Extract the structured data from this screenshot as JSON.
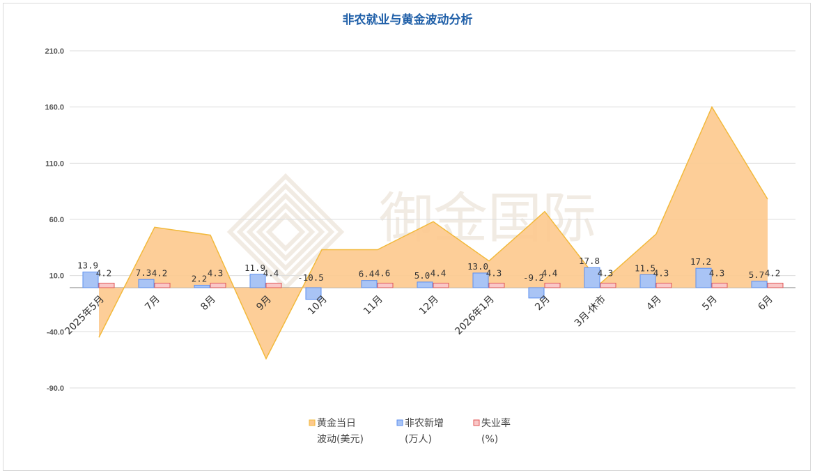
{
  "chart_data": {
    "type": "bar",
    "title": "非农就业与黄金波动分析",
    "categories": [
      "2025年5月",
      "7月",
      "8月",
      "9月",
      "10月",
      "11月",
      "12月",
      "2026年1月",
      "2月",
      "3月-休市",
      "4月",
      "5月",
      "6月"
    ],
    "ylim": [
      -90,
      210
    ],
    "yticks": [
      "210.0",
      "160.0",
      "110.0",
      "60.0",
      "10.0",
      "-40.0",
      "-90.0"
    ],
    "ytick_values": [
      210,
      160,
      110,
      60,
      10,
      -40,
      -90
    ],
    "grid": true,
    "legend_position": "bottom",
    "series": [
      {
        "name": "黄金当日波动(美元)",
        "type": "area",
        "color": "#fdc98d",
        "line_color": "#f2b93b",
        "values": [
          -45,
          53,
          46,
          -64,
          33,
          33,
          58,
          23,
          67,
          3,
          47,
          160,
          78
        ]
      },
      {
        "name": "非农新增(万人)",
        "type": "bar",
        "color": "#a9c4f5",
        "border": "#5b8ff0",
        "values": [
          13.9,
          7.3,
          2.2,
          11.9,
          -10.5,
          6.4,
          5.0,
          13.0,
          -9.2,
          17.8,
          11.5,
          17.2,
          5.7
        ],
        "labels": [
          "13.9",
          "7.3",
          "2.2",
          "11.9",
          "-10.5",
          "6.4",
          "5.0",
          "13.0",
          "-9.2",
          "17.8",
          "11.5",
          "17.2",
          "5.7"
        ]
      },
      {
        "name": "失业率(%)",
        "type": "bar",
        "color": "#f9c7c7",
        "border": "#e05555",
        "values": [
          4.2,
          4.2,
          4.3,
          4.4,
          0,
          4.6,
          4.4,
          4.3,
          4.4,
          4.3,
          4.3,
          4.3,
          4.2
        ],
        "labels": [
          "4.2",
          "4.2",
          "4.3",
          "4.4",
          "",
          "4.6",
          "4.4",
          "4.3",
          "4.4",
          "4.3",
          "4.3",
          "4.3",
          "4.2"
        ]
      }
    ],
    "legend": [
      {
        "line1": "黄金当日",
        "line2": "波动(美元)",
        "color": "#f2b93b",
        "fill": "#fdc98d"
      },
      {
        "line1": "非农新增",
        "line2": "(万人)",
        "color": "#5b8ff0",
        "fill": "#a9c4f5"
      },
      {
        "line1": "失业率",
        "line2": "(%)",
        "color": "#e05555",
        "fill": "#f9c7c7"
      }
    ]
  },
  "watermark": {
    "text": "御金国际"
  }
}
